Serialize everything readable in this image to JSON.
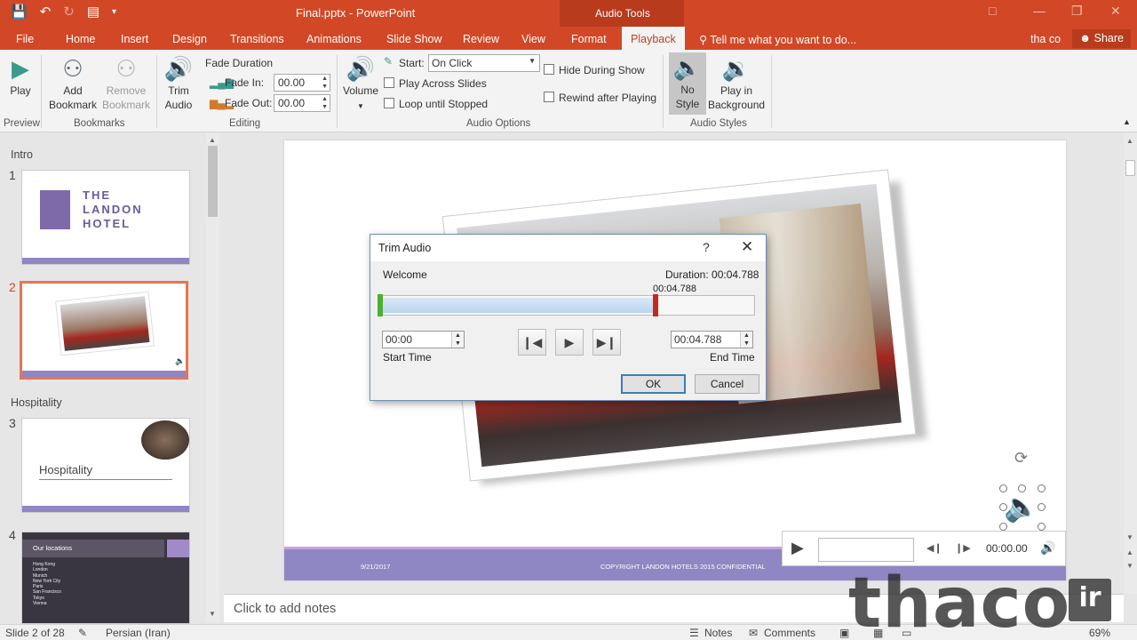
{
  "titlebar": {
    "title": "Final.pptx - PowerPoint",
    "contextual_group": "Audio Tools"
  },
  "tabs": [
    {
      "label": "File"
    },
    {
      "label": "Home"
    },
    {
      "label": "Insert"
    },
    {
      "label": "Design"
    },
    {
      "label": "Transitions"
    },
    {
      "label": "Animations"
    },
    {
      "label": "Slide Show"
    },
    {
      "label": "Review"
    },
    {
      "label": "View"
    },
    {
      "label": "Format"
    },
    {
      "label": "Playback"
    }
  ],
  "tell_me": "Tell me what you want to do...",
  "user": "tha co",
  "share": "Share",
  "ribbon": {
    "play": "Play",
    "add_bookmark": [
      "Add",
      "Bookmark"
    ],
    "remove_bookmark": [
      "Remove",
      "Bookmark"
    ],
    "trim_audio": [
      "Trim",
      "Audio"
    ],
    "fade_duration": "Fade Duration",
    "fade_in_label": "Fade In:",
    "fade_in_value": "00.00",
    "fade_out_label": "Fade Out:",
    "fade_out_value": "00.00",
    "volume": "Volume",
    "start_label": "Start:",
    "start_value": "On Click",
    "play_across": "Play Across Slides",
    "loop": "Loop until Stopped",
    "hide_during_show": "Hide During Show",
    "rewind": "Rewind after Playing",
    "no_style": [
      "No",
      "Style"
    ],
    "play_in_bg": [
      "Play in",
      "Background"
    ],
    "groups": {
      "preview": "Preview",
      "bookmarks": "Bookmarks",
      "editing": "Editing",
      "audio_options": "Audio Options",
      "audio_styles": "Audio Styles"
    }
  },
  "thumbnails": {
    "sections": [
      "Intro",
      "Hospitality"
    ],
    "slides": [
      {
        "num": "1",
        "title": "THE\nLANDON\nHOTEL"
      },
      {
        "num": "2"
      },
      {
        "num": "3",
        "title": "Hospitality"
      },
      {
        "num": "4",
        "title": "Our locations",
        "items": [
          "Hong Kong",
          "London",
          "Munich",
          "New York City",
          "Paris",
          "San Francisco",
          "Tokyo",
          "Vienna"
        ]
      }
    ]
  },
  "slide": {
    "footer_date": "9/21/2017",
    "footer_copyright": "COPYRIGHT LANDON HOTELS 2015 CONFIDENTIAL"
  },
  "media": {
    "time": "00:00.00"
  },
  "dialog": {
    "title": "Trim Audio",
    "help": "?",
    "audio_name": "Welcome",
    "duration": "Duration: 00:04.788",
    "marker_time": "00:04.788",
    "start_value": "00:00",
    "start_label": "Start Time",
    "end_value": "00:04.788",
    "end_label": "End Time",
    "ok": "OK",
    "cancel": "Cancel"
  },
  "notes_placeholder": "Click to add notes",
  "status": {
    "slide": "Slide 2 of 28",
    "language": "Persian (Iran)",
    "notes": "Notes",
    "comments": "Comments",
    "zoom": "69%"
  },
  "watermark": {
    "text": "thaco",
    "suffix": "ir"
  }
}
